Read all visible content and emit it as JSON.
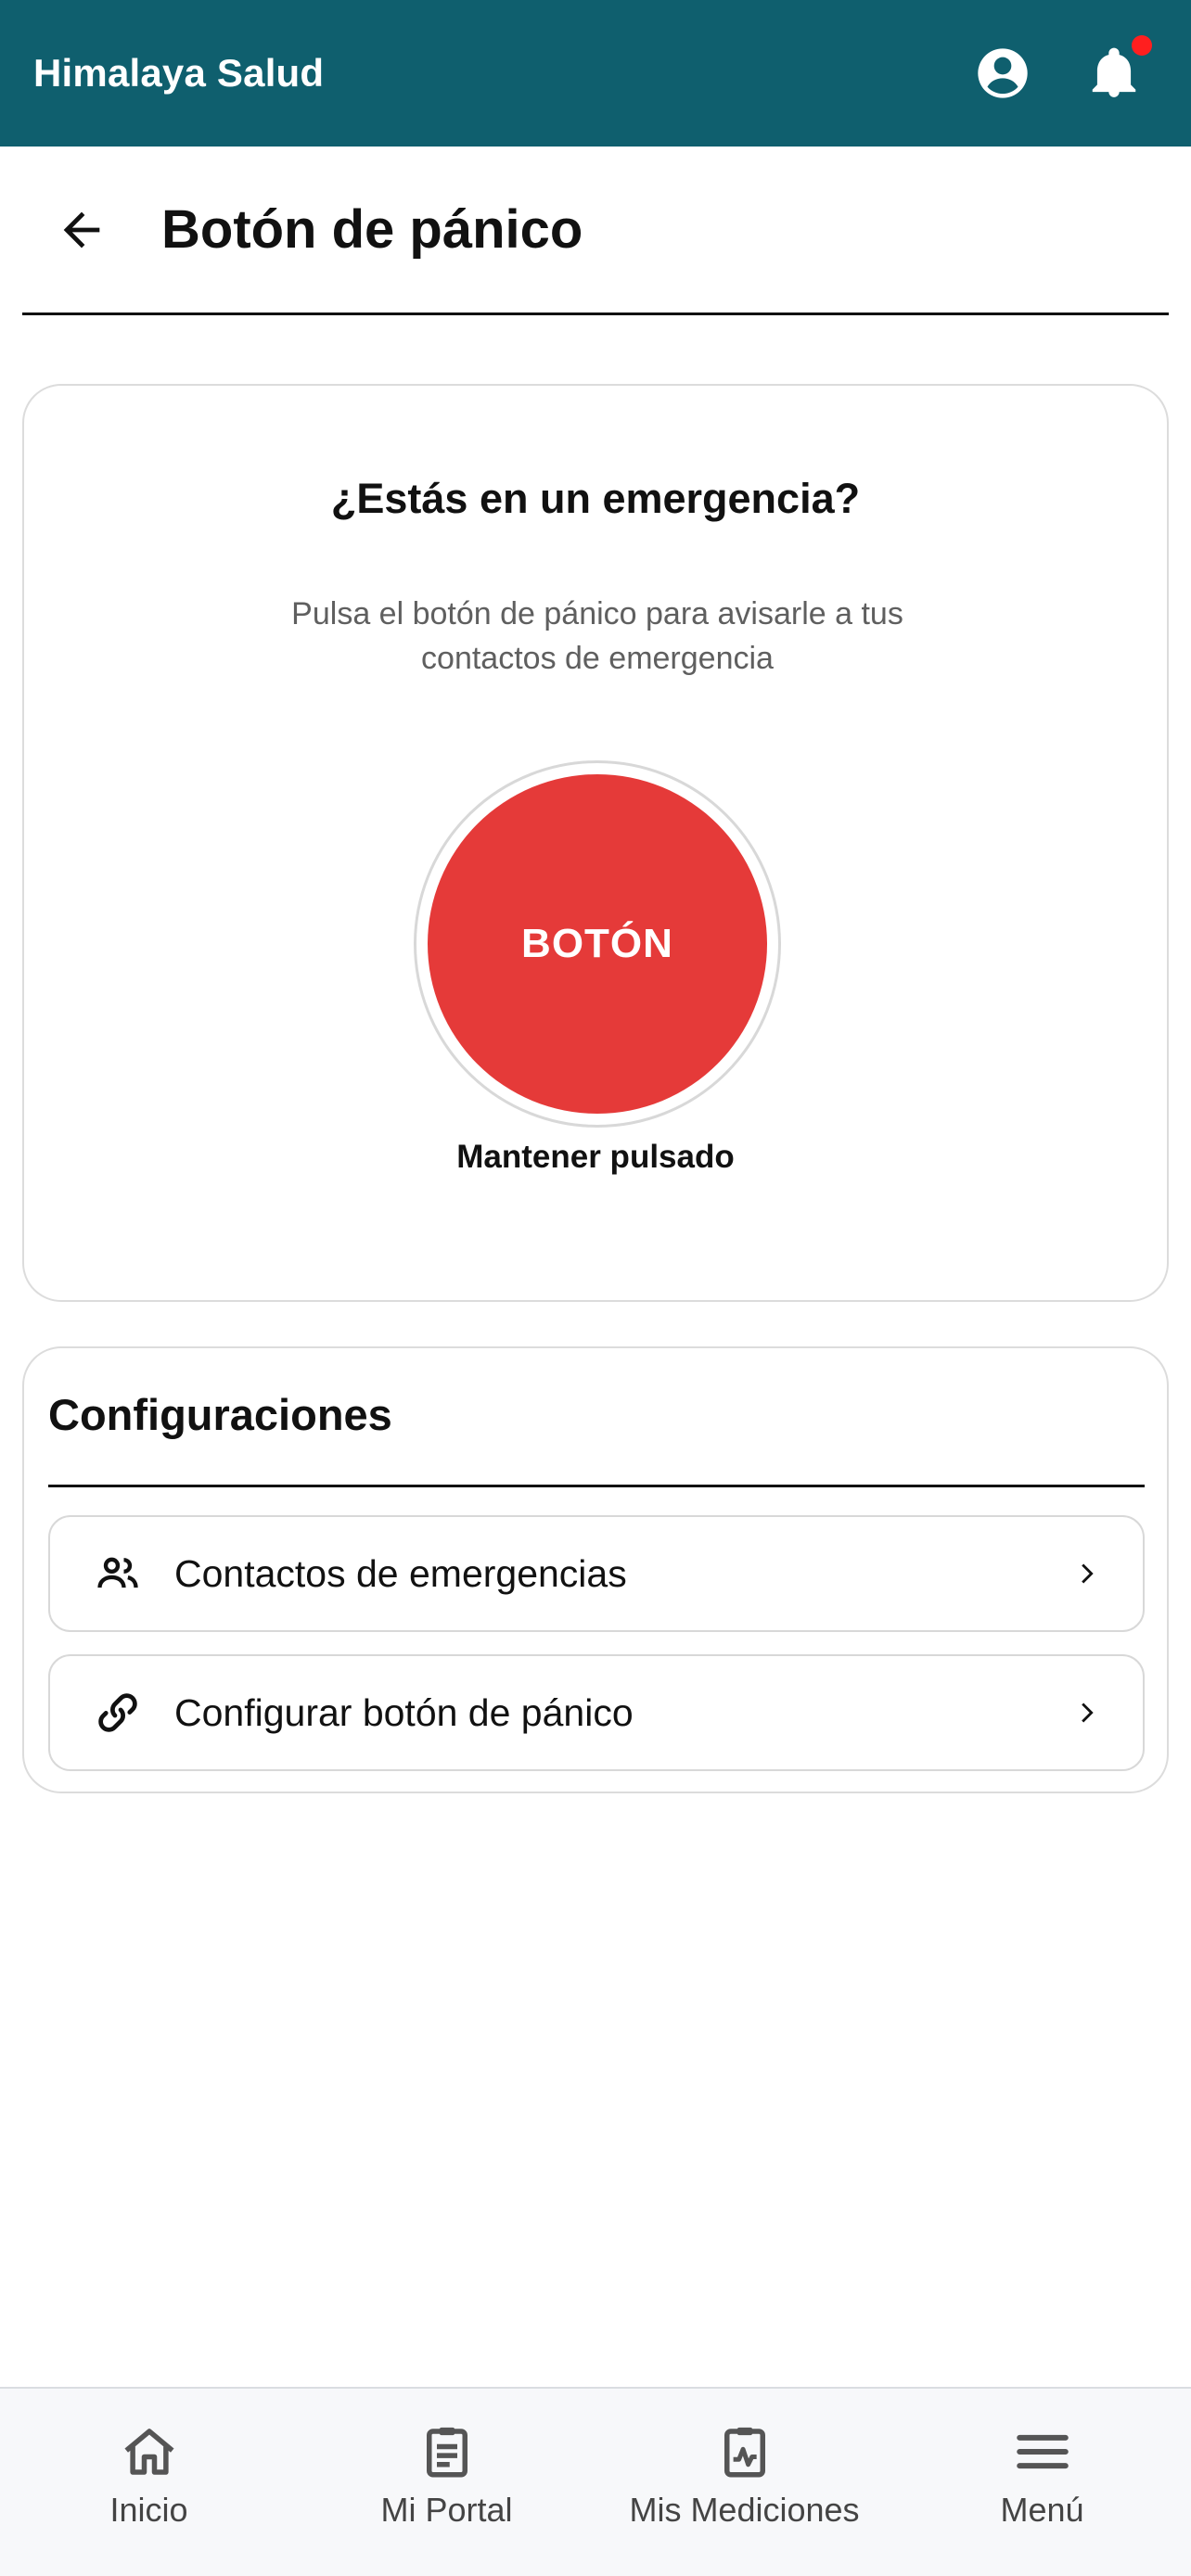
{
  "header": {
    "app_name": "Himalaya Salud",
    "profile_icon": "account-circle-icon",
    "notifications_icon": "bell-icon",
    "notification_badge_color": "#ff1f1f",
    "background_color": "#0f5f6e"
  },
  "page": {
    "title": "Botón de pánico",
    "back_icon": "arrow-left-icon"
  },
  "emergency": {
    "title": "¿Estás en un emergencia?",
    "description": "Pulsa el botón de pánico para avisarle a tus contactos de emergencia",
    "button_label": "BOTÓN",
    "hold_label": "Mantener pulsado",
    "button_color": "#e53a39"
  },
  "settings": {
    "title": "Configuraciones",
    "items": [
      {
        "label": "Contactos de emergencias",
        "icon": "people-icon"
      },
      {
        "label": "Configurar botón de pánico",
        "icon": "link-icon"
      }
    ]
  },
  "bottom_nav": {
    "items": [
      {
        "label": "Inicio",
        "icon": "home-icon"
      },
      {
        "label": "Mi Portal",
        "icon": "clipboard-icon"
      },
      {
        "label": "Mis Mediciones",
        "icon": "measurements-icon"
      },
      {
        "label": "Menú",
        "icon": "menu-icon"
      }
    ]
  }
}
